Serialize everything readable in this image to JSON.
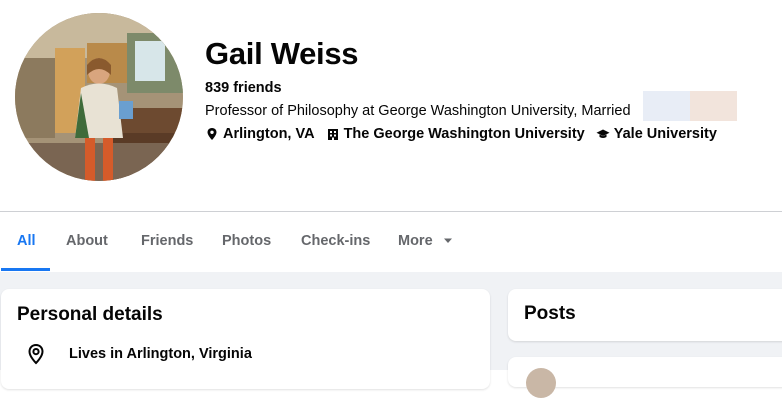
{
  "profile": {
    "name": "Gail Weiss",
    "friends": "839 friends",
    "bio": "Professor of Philosophy at George Washington University, Married",
    "facts": [
      {
        "icon": "map-pin-icon",
        "label": "Arlington, VA"
      },
      {
        "icon": "building-icon",
        "label": "The George Washington University"
      },
      {
        "icon": "graduation-cap-icon",
        "label": "Yale University"
      }
    ]
  },
  "tabs": [
    {
      "label": "All",
      "active": true
    },
    {
      "label": "About"
    },
    {
      "label": "Friends"
    },
    {
      "label": "Photos"
    },
    {
      "label": "Check-ins"
    },
    {
      "label": "More",
      "icon": "caret-down-icon"
    }
  ],
  "personal_details": {
    "title": "Personal details",
    "lives_in": "Lives in Arlington, Virginia"
  },
  "posts": {
    "title": "Posts"
  },
  "colors": {
    "accent": "#1877f2",
    "muted_text": "#65676b",
    "page_bg": "#f0f2f5"
  }
}
